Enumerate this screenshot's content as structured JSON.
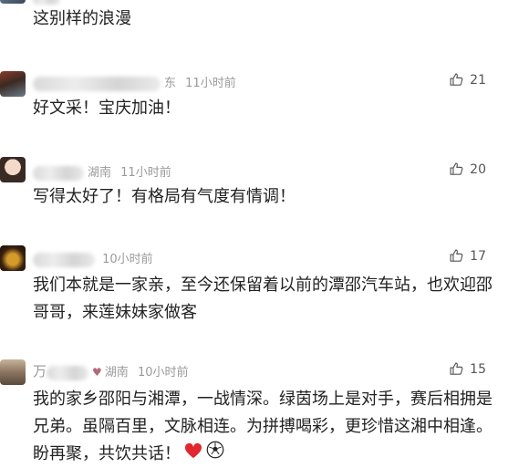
{
  "comments": [
    {
      "prefix": "",
      "region": "",
      "time": "",
      "text": "这别样的浪漫",
      "likes": ""
    },
    {
      "prefix": "",
      "region": "东",
      "time": "11小时前",
      "text": "好文采！宝庆加油！",
      "likes": "21"
    },
    {
      "prefix": "",
      "region": "湖南",
      "time": "11小时前",
      "text": "写得太好了！有格局有气度有情调！",
      "likes": "20"
    },
    {
      "prefix": "",
      "region": "",
      "time": "10小时前",
      "text": "我们本就是一家亲，至今还保留着以前的潭邵汽车站，也欢迎邵哥哥，来莲妹妹家做客",
      "likes": "17"
    },
    {
      "prefix": "万",
      "region": "湖南",
      "time": "10小时前",
      "text": "我的家乡邵阳与湘潭，一战情深。绿茵场上是对手，赛后相拥是兄弟。虽隔百里，文脉相连。为拼搏喝彩，更珍惜这湘中相逢。盼再聚，共饮共话！",
      "likes": "15"
    }
  ],
  "colors": {
    "meta": "#9a9a9a",
    "text": "#222222",
    "heart": "#e0282e"
  },
  "icons": [
    "thumbs-up-icon",
    "heart-icon",
    "soccer-ball-icon"
  ]
}
